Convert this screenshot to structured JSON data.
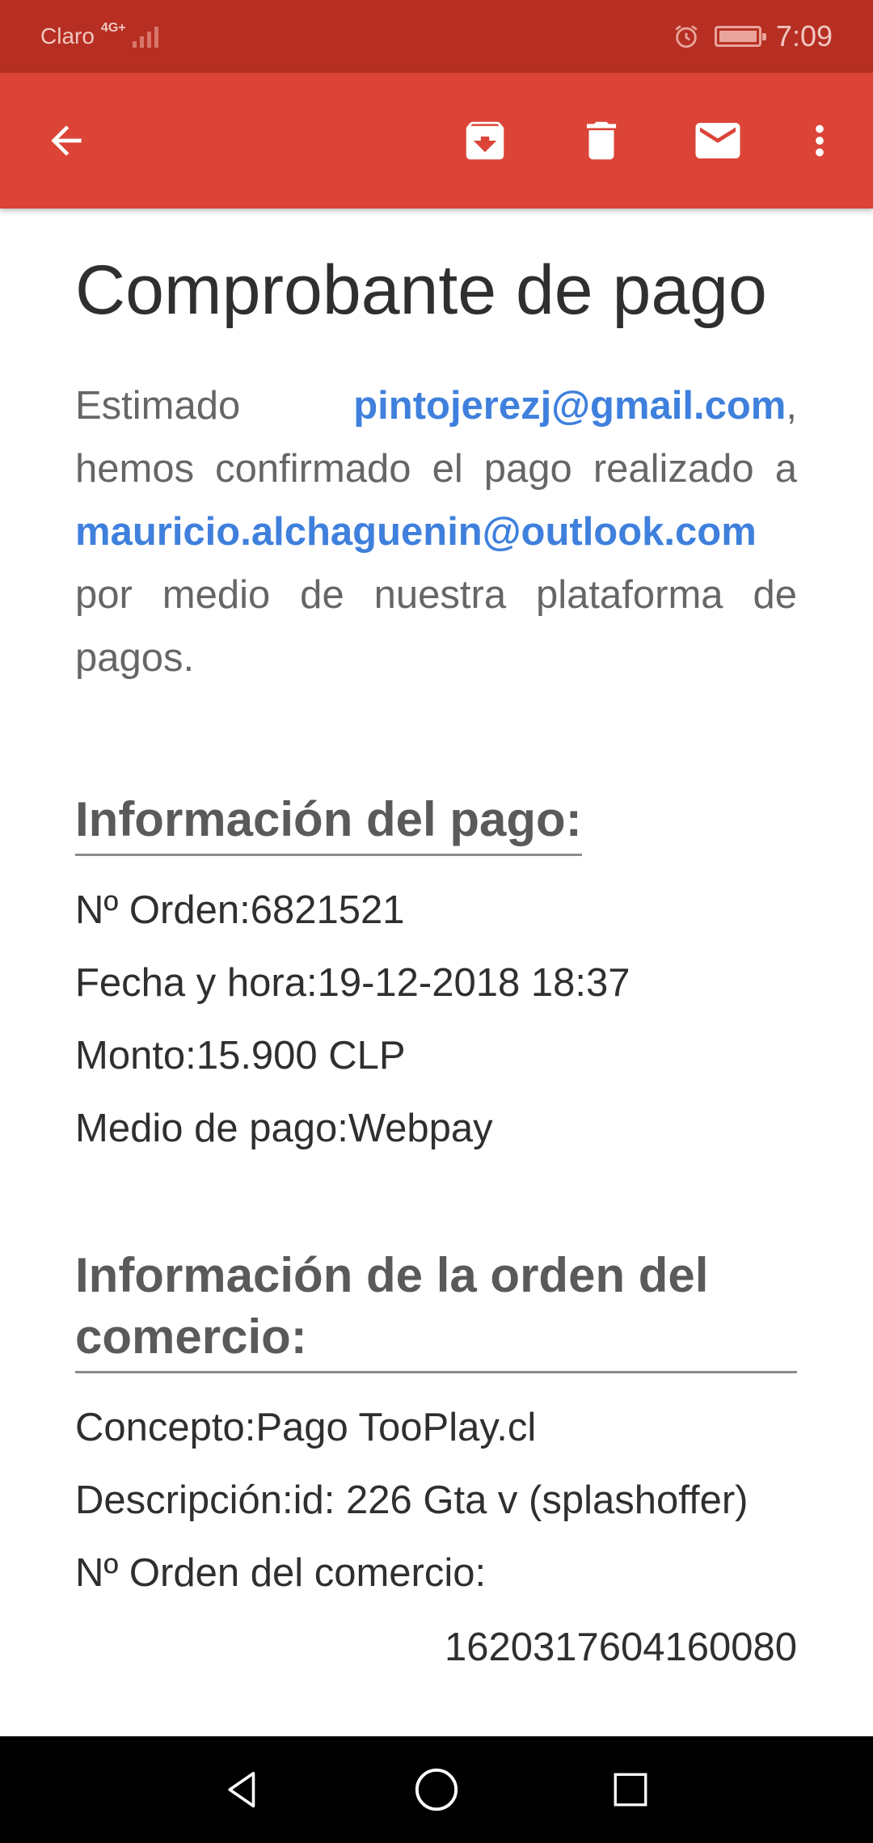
{
  "status": {
    "carrier": "Claro",
    "network": "4G+",
    "time": "7:09"
  },
  "toolbar": {
    "back_icon": "arrow-back-icon",
    "archive_icon": "archive-icon",
    "delete_icon": "delete-icon",
    "mark_unread_icon": "mail-icon",
    "more_icon": "more-vert-icon"
  },
  "email": {
    "title": "Comprobante de pago",
    "intro_word": "Estimado",
    "sender_email": "pintojerezj@gmail.com",
    "comma": ",",
    "confirmed_text": "hemos confirmado el pago realizado a",
    "merchant_email": "mauricio.alchaguenin@outlook.com",
    "platform_text": "por medio de nuestra plataforma de pagos.",
    "payment_info": {
      "heading": "Información del pago:",
      "order_label": "Nº Orden:",
      "order_value": "6821521",
      "date_label": "Fecha y hora:",
      "date_value": "19-12-2018 18:37",
      "amount_label": "Monto:",
      "amount_value": "15.900 CLP",
      "method_label": "Medio de pago:",
      "method_value": "Webpay"
    },
    "merchant_info": {
      "heading": "Información de la orden del comercio:",
      "concept_label": "Concepto:",
      "concept_value": "Pago TooPlay.cl",
      "description_label": "Descripción:",
      "description_value": "id: 226 Gta v (splashoffer)",
      "merchant_order_label": "Nº Orden del comercio:",
      "merchant_order_value": "1620317604160080"
    }
  },
  "colors": {
    "status_bar": "#b62f22",
    "app_bar": "#db4437",
    "link": "#3f80dd"
  }
}
